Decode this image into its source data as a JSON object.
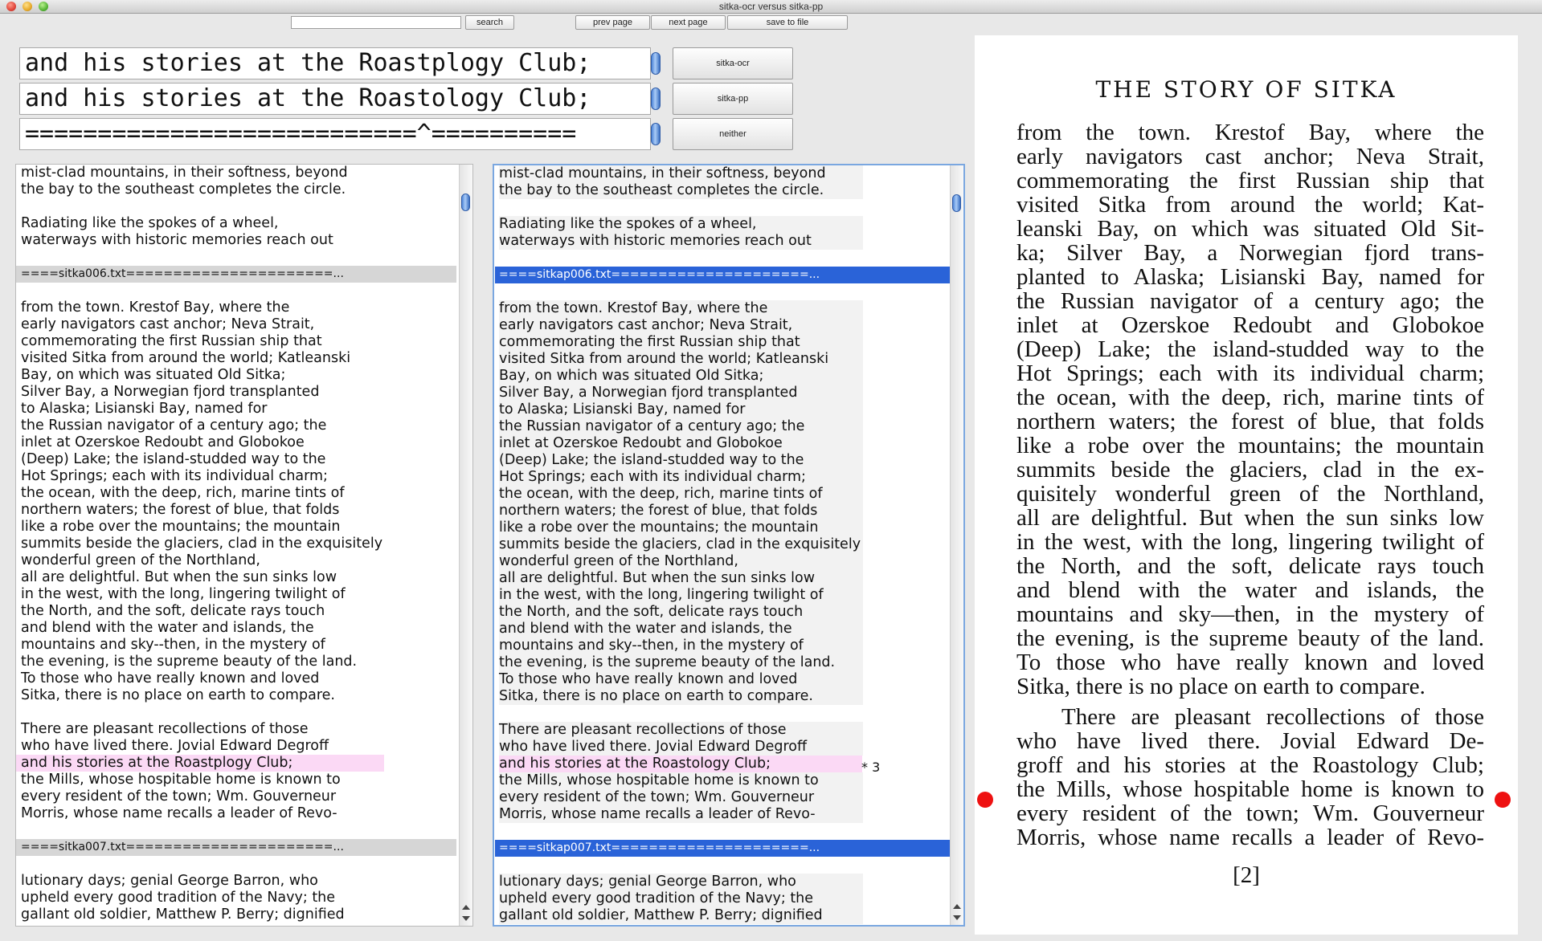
{
  "window": {
    "title": "sitka-ocr versus sitka-pp"
  },
  "toolbar": {
    "search_value": "",
    "search_label": "search",
    "prev_label": "prev page",
    "next_label": "next page",
    "save_label": "save to file"
  },
  "compare": {
    "ocr_line": "and his stories at the Roastplogy Club;",
    "pp_line": "and his stories at the Roastology Club;",
    "marker_line": "===========================^==========",
    "buttons": {
      "ocr": "sitka-ocr",
      "pp": "sitka-pp",
      "neither": "neither"
    }
  },
  "left_pane": {
    "lines": [
      {
        "t": "mist-clad mountains, in their softness, beyond"
      },
      {
        "t": "the bay to the southeast completes the circle."
      },
      {
        "t": ""
      },
      {
        "t": "Radiating like the spokes of a wheel,"
      },
      {
        "t": "waterways with historic memories reach out"
      },
      {
        "t": ""
      },
      {
        "t": "====sitka006.txt======================...",
        "sep": true
      },
      {
        "t": ""
      },
      {
        "t": "from the town. Krestof Bay, where the"
      },
      {
        "t": "early navigators cast anchor; Neva Strait,"
      },
      {
        "t": "commemorating the first Russian ship that"
      },
      {
        "t": "visited Sitka from around the world; Katleanski"
      },
      {
        "t": "Bay, on which was situated Old Sitka;"
      },
      {
        "t": "Silver Bay, a Norwegian fjord transplanted"
      },
      {
        "t": "to Alaska; Lisianski Bay, named for"
      },
      {
        "t": "the Russian navigator of a century ago; the"
      },
      {
        "t": "inlet at Ozerskoe Redoubt and Globokoe"
      },
      {
        "t": "(Deep) Lake; the island-studded way to the"
      },
      {
        "t": "Hot Springs; each with its individual charm;"
      },
      {
        "t": "the ocean, with the deep, rich, marine tints of"
      },
      {
        "t": "northern waters; the forest of blue, that folds"
      },
      {
        "t": "like a robe over the mountains; the mountain"
      },
      {
        "t": "summits beside the glaciers, clad in the exquisitely"
      },
      {
        "t": "wonderful green of the Northland,"
      },
      {
        "t": "all are delightful. But when the sun sinks low"
      },
      {
        "t": "in the west, with the long, lingering twilight of"
      },
      {
        "t": "the North, and the soft, delicate rays touch"
      },
      {
        "t": "and blend with the water and islands, the"
      },
      {
        "t": "mountains and sky--then, in the mystery of"
      },
      {
        "t": "the evening, is the supreme beauty of the land."
      },
      {
        "t": "To those who have really known and loved"
      },
      {
        "t": "Sitka, there is no place on earth to compare."
      },
      {
        "t": ""
      },
      {
        "t": "There are pleasant recollections of those"
      },
      {
        "t": "who have lived there. Jovial Edward Degroff"
      },
      {
        "t": "and his stories at the Roastplogy Club;",
        "hl": true
      },
      {
        "t": "the Mills, whose hospitable home is known to"
      },
      {
        "t": "every resident of the town; Wm. Gouverneur"
      },
      {
        "t": "Morris, whose name recalls a leader of Revo-"
      },
      {
        "t": ""
      },
      {
        "t": "====sitka007.txt======================...",
        "sep": true
      },
      {
        "t": ""
      },
      {
        "t": "lutionary days; genial George Barron, who"
      },
      {
        "t": "upheld every good tradition of the Navy; the"
      },
      {
        "t": "gallant old soldier, Matthew P. Berry; dignified"
      }
    ]
  },
  "right_pane": {
    "diff_marker": "* 3",
    "lines": [
      {
        "t": "mist-clad mountains, in their softness, beyond"
      },
      {
        "t": "the bay to the southeast completes the circle."
      },
      {
        "t": ""
      },
      {
        "t": "Radiating like the spokes of a wheel,"
      },
      {
        "t": "waterways with historic memories reach out"
      },
      {
        "t": ""
      },
      {
        "t": "====sitkap006.txt=====================...",
        "sep": true
      },
      {
        "t": ""
      },
      {
        "t": "from the town. Krestof Bay, where the"
      },
      {
        "t": "early navigators cast anchor; Neva Strait,"
      },
      {
        "t": "commemorating the first Russian ship that"
      },
      {
        "t": "visited Sitka from around the world; Katleanski"
      },
      {
        "t": "Bay, on which was situated Old Sitka;"
      },
      {
        "t": "Silver Bay, a Norwegian fjord transplanted"
      },
      {
        "t": "to Alaska; Lisianski Bay, named for"
      },
      {
        "t": "the Russian navigator of a century ago; the"
      },
      {
        "t": "inlet at Ozerskoe Redoubt and Globokoe"
      },
      {
        "t": "(Deep) Lake; the island-studded way to the"
      },
      {
        "t": "Hot Springs; each with its individual charm;"
      },
      {
        "t": "the ocean, with the deep, rich, marine tints of"
      },
      {
        "t": "northern waters; the forest of blue, that folds"
      },
      {
        "t": "like a robe over the mountains; the mountain"
      },
      {
        "t": "summits beside the glaciers, clad in the exquisitely"
      },
      {
        "t": "wonderful green of the Northland,"
      },
      {
        "t": "all are delightful. But when the sun sinks low"
      },
      {
        "t": "in the west, with the long, lingering twilight of"
      },
      {
        "t": "the North, and the soft, delicate rays touch"
      },
      {
        "t": "and blend with the water and islands, the"
      },
      {
        "t": "mountains and sky--then, in the mystery of"
      },
      {
        "t": "the evening, is the supreme beauty of the land."
      },
      {
        "t": "To those who have really known and loved"
      },
      {
        "t": "Sitka, there is no place on earth to compare."
      },
      {
        "t": ""
      },
      {
        "t": "There are pleasant recollections of those"
      },
      {
        "t": "who have lived there. Jovial Edward Degroff"
      },
      {
        "t": "and his stories at the Roastology Club;",
        "hl": true
      },
      {
        "t": "the Mills, whose hospitable home is known to"
      },
      {
        "t": "every resident of the town; Wm. Gouverneur"
      },
      {
        "t": "Morris, whose name recalls a leader of Revo-"
      },
      {
        "t": ""
      },
      {
        "t": "====sitkap007.txt=====================...",
        "sep": true
      },
      {
        "t": ""
      },
      {
        "t": "lutionary days; genial George Barron, who"
      },
      {
        "t": "upheld every good tradition of the Navy; the"
      },
      {
        "t": "gallant old soldier, Matthew P. Berry; dignified"
      }
    ]
  },
  "page_image": {
    "heading": "THE STORY OF SITKA",
    "page_number": "[2]",
    "lines": [
      {
        "t": "from the town. Krestof Bay, where the"
      },
      {
        "t": "early navigators cast anchor; Neva Strait,"
      },
      {
        "t": "commemorating the first Russian ship that"
      },
      {
        "t": "visited Sitka from around the world; Kat-"
      },
      {
        "t": "leanski Bay, on which was situated Old Sit-"
      },
      {
        "t": "ka; Silver Bay, a Norwegian fjord trans-"
      },
      {
        "t": "planted to Alaska; Lisianski Bay, named for"
      },
      {
        "t": "the Russian navigator of a century ago; the"
      },
      {
        "t": "inlet at Ozerskoe Redoubt and Globokoe"
      },
      {
        "t": "(Deep) Lake; the island-studded way to the"
      },
      {
        "t": "Hot Springs; each with its individual charm;"
      },
      {
        "t": "the ocean, with the deep, rich, marine tints of"
      },
      {
        "t": "northern waters; the forest of blue, that folds"
      },
      {
        "t": "like a robe over the mountains; the mountain"
      },
      {
        "t": "summits beside the glaciers, clad in the ex-"
      },
      {
        "t": "quisitely wonderful green of the Northland,"
      },
      {
        "t": "all are delightful. But when the sun sinks low"
      },
      {
        "t": "in the west, with the long, lingering twilight of"
      },
      {
        "t": "the North, and the soft, delicate rays touch"
      },
      {
        "t": "and blend with the water and islands, the"
      },
      {
        "t": "mountains and sky—then, in the mystery of"
      },
      {
        "t": "the evening, is the supreme beauty of the land."
      },
      {
        "t": "To those who have really known and loved"
      },
      {
        "t": "Sitka, there is no place on earth to compare.",
        "last": true
      },
      {
        "t": "There are pleasant recollections of those",
        "indent": true
      },
      {
        "t": "who have lived there. Jovial Edward De-"
      },
      {
        "t": "groff and his stories at the Roastology Club;"
      },
      {
        "t": "the Mills, whose hospitable home is known to"
      },
      {
        "t": "every resident of the town; Wm. Gouverneur"
      },
      {
        "t": "Morris, whose name recalls a leader of Revo-"
      }
    ]
  }
}
